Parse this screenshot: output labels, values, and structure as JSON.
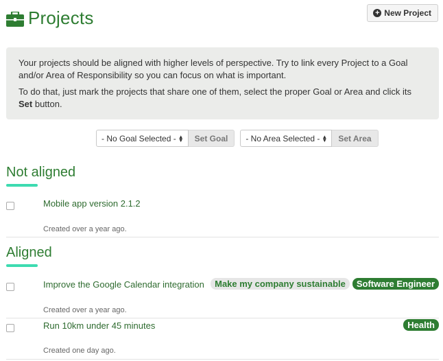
{
  "header": {
    "title": "Projects",
    "new_project_label": "New Project"
  },
  "info": {
    "line1": "Your projects should be aligned with higher levels of perspective. Try to link every Project to a Goal and/or Area of Responsibility so you can focus on what is important.",
    "line2_prefix": "To do that, just mark the projects that share one of them, select the proper Goal or Area and click its ",
    "line2_bold": "Set",
    "line2_suffix": " button."
  },
  "controls": {
    "goal_select": "- No Goal Selected -",
    "set_goal_label": "Set Goal",
    "area_select": "- No Area Selected -",
    "set_area_label": "Set Area"
  },
  "sections": {
    "not_aligned": {
      "title": "Not aligned",
      "projects": [
        {
          "name": "Mobile app version 2.1.2",
          "created": "Created over a year ago."
        }
      ]
    },
    "aligned": {
      "title": "Aligned",
      "projects": [
        {
          "name": "Improve the Google Calendar integration",
          "created": "Created over a year ago.",
          "goal": "Make my company sustainable",
          "area": "Software Engineer"
        },
        {
          "name": "Run 10km under 45 minutes",
          "created": "Created one day ago.",
          "area": "Health"
        }
      ]
    }
  },
  "colors": {
    "brand_green": "#2e7d32",
    "accent_teal": "#3ddbb0",
    "info_bg": "#ebecea"
  },
  "icons": {
    "header": "briefcase-icon",
    "new_project": "plus-circle-icon",
    "select": "updown-icon"
  }
}
